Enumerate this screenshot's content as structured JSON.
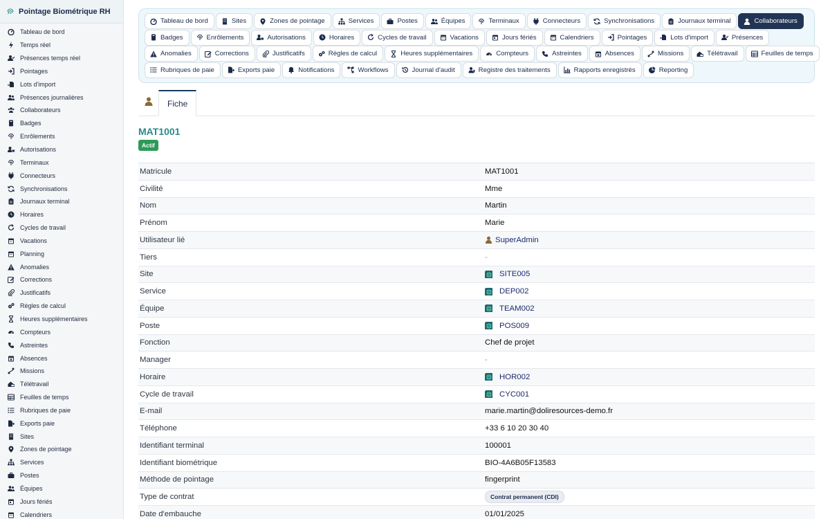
{
  "app": {
    "title": "Pointage Biométrique RH"
  },
  "sidebar": {
    "items": [
      {
        "label": "Tableau de bord",
        "icon": "dashboard-icon"
      },
      {
        "label": "Temps réel",
        "icon": "bolt-icon"
      },
      {
        "label": "Présences temps réel",
        "icon": "user-check-icon"
      },
      {
        "label": "Pointages",
        "icon": "login-icon"
      },
      {
        "label": "Lots d'import",
        "icon": "file-import-icon"
      },
      {
        "label": "Présences journalières",
        "icon": "users-icon"
      },
      {
        "label": "Collaborateurs",
        "icon": "users-group-icon"
      },
      {
        "label": "Badges",
        "icon": "badge-icon"
      },
      {
        "label": "Enrôlements",
        "icon": "fingerprint-icon"
      },
      {
        "label": "Autorisations",
        "icon": "user-lock-icon"
      },
      {
        "label": "Terminaux",
        "icon": "fingerprint-icon"
      },
      {
        "label": "Connecteurs",
        "icon": "plug-icon"
      },
      {
        "label": "Synchronisations",
        "icon": "sync-icon"
      },
      {
        "label": "Journaux terminal",
        "icon": "clipboard-icon"
      },
      {
        "label": "Horaires",
        "icon": "clock-icon"
      },
      {
        "label": "Cycles de travail",
        "icon": "rotate-icon"
      },
      {
        "label": "Vacations",
        "icon": "calendar-icon"
      },
      {
        "label": "Planning",
        "icon": "calendar-icon"
      },
      {
        "label": "Anomalies",
        "icon": "warning-icon"
      },
      {
        "label": "Corrections",
        "icon": "edit-icon"
      },
      {
        "label": "Justificatifs",
        "icon": "paperclip-icon"
      },
      {
        "label": "Règles de calcul",
        "icon": "cogs-icon"
      },
      {
        "label": "Heures supplémentaires",
        "icon": "hourglass-icon"
      },
      {
        "label": "Compteurs",
        "icon": "gauge-icon"
      },
      {
        "label": "Astreintes",
        "icon": "phone-icon"
      },
      {
        "label": "Absences",
        "icon": "calendar-x-icon"
      },
      {
        "label": "Missions",
        "icon": "route-icon"
      },
      {
        "label": "Télétravail",
        "icon": "house-laptop-icon"
      },
      {
        "label": "Feuilles de temps",
        "icon": "table-icon"
      },
      {
        "label": "Rubriques de paie",
        "icon": "list-icon"
      },
      {
        "label": "Exports paie",
        "icon": "file-export-icon"
      },
      {
        "label": "Sites",
        "icon": "building-icon"
      },
      {
        "label": "Zones de pointage",
        "icon": "map-pin-icon"
      },
      {
        "label": "Services",
        "icon": "sitemap-icon"
      },
      {
        "label": "Postes",
        "icon": "briefcase-icon"
      },
      {
        "label": "Équipes",
        "icon": "users-icon"
      },
      {
        "label": "Jours fériés",
        "icon": "calendar-day-icon"
      },
      {
        "label": "Calendriers",
        "icon": "calendar-icon"
      }
    ]
  },
  "topmenu": {
    "rows": [
      [
        {
          "label": "Tableau de bord",
          "icon": "dashboard-icon"
        },
        {
          "label": "Sites",
          "icon": "building-icon"
        },
        {
          "label": "Zones de pointage",
          "icon": "map-pin-icon"
        },
        {
          "label": "Services",
          "icon": "sitemap-icon"
        },
        {
          "label": "Postes",
          "icon": "briefcase-icon"
        },
        {
          "label": "Équipes",
          "icon": "users-icon"
        },
        {
          "label": "Terminaux",
          "icon": "fingerprint-icon"
        },
        {
          "label": "Connecteurs",
          "icon": "plug-icon"
        },
        {
          "label": "Synchronisations",
          "icon": "sync-icon"
        },
        {
          "label": "Journaux terminal",
          "icon": "clipboard-icon"
        },
        {
          "label": "Collaborateurs",
          "icon": "user-icon",
          "active": true
        }
      ],
      [
        {
          "label": "Badges",
          "icon": "badge-icon"
        },
        {
          "label": "Enrôlements",
          "icon": "fingerprint-icon"
        },
        {
          "label": "Autorisations",
          "icon": "user-lock-icon"
        },
        {
          "label": "Horaires",
          "icon": "clock-icon"
        },
        {
          "label": "Cycles de travail",
          "icon": "rotate-icon"
        },
        {
          "label": "Vacations",
          "icon": "calendar-icon"
        },
        {
          "label": "Jours fériés",
          "icon": "calendar-day-icon"
        },
        {
          "label": "Calendriers",
          "icon": "calendar-icon"
        },
        {
          "label": "Pointages",
          "icon": "login-icon"
        },
        {
          "label": "Lots d'import",
          "icon": "file-import-icon"
        },
        {
          "label": "Présences",
          "icon": "user-check-icon"
        }
      ],
      [
        {
          "label": "Anomalies",
          "icon": "warning-icon"
        },
        {
          "label": "Corrections",
          "icon": "edit-icon"
        },
        {
          "label": "Justificatifs",
          "icon": "paperclip-icon"
        },
        {
          "label": "Règles de calcul",
          "icon": "cogs-icon"
        },
        {
          "label": "Heures supplémentaires",
          "icon": "hourglass-icon"
        },
        {
          "label": "Compteurs",
          "icon": "gauge-icon"
        },
        {
          "label": "Astreintes",
          "icon": "phone-icon"
        },
        {
          "label": "Absences",
          "icon": "calendar-x-icon"
        },
        {
          "label": "Missions",
          "icon": "route-icon"
        },
        {
          "label": "Télétravail",
          "icon": "house-laptop-icon"
        },
        {
          "label": "Feuilles de temps",
          "icon": "table-icon"
        }
      ],
      [
        {
          "label": "Rubriques de paie",
          "icon": "list-icon"
        },
        {
          "label": "Exports paie",
          "icon": "file-export-icon"
        },
        {
          "label": "Notifications",
          "icon": "bell-icon"
        },
        {
          "label": "Workflows",
          "icon": "workflow-icon"
        },
        {
          "label": "Journal d'audit",
          "icon": "history-icon"
        },
        {
          "label": "Registre des traitements",
          "icon": "user-shield-icon"
        },
        {
          "label": "Rapports enregistrés",
          "icon": "chart-icon"
        },
        {
          "label": "Reporting",
          "icon": "pie-chart-icon"
        }
      ]
    ]
  },
  "tabs": {
    "fiche_label": "Fiche"
  },
  "record": {
    "ref": "MAT1001",
    "status": "Actif",
    "fields": [
      {
        "label": "Matricule",
        "value": "MAT1001",
        "type": "text"
      },
      {
        "label": "Civilité",
        "value": "Mme",
        "type": "text"
      },
      {
        "label": "Nom",
        "value": "Martin",
        "type": "text"
      },
      {
        "label": "Prénom",
        "value": "Marie",
        "type": "text"
      },
      {
        "label": "Utilisateur lié",
        "value": "SuperAdmin",
        "type": "user"
      },
      {
        "label": "Tiers",
        "value": "-",
        "type": "dash"
      },
      {
        "label": "Site",
        "value": "SITE005",
        "type": "link"
      },
      {
        "label": "Service",
        "value": "DEP002",
        "type": "link"
      },
      {
        "label": "Équipe",
        "value": "TEAM002",
        "type": "link"
      },
      {
        "label": "Poste",
        "value": "POS009",
        "type": "link"
      },
      {
        "label": "Fonction",
        "value": "Chef de projet",
        "type": "text"
      },
      {
        "label": "Manager",
        "value": "-",
        "type": "dash"
      },
      {
        "label": "Horaire",
        "value": "HOR002",
        "type": "link"
      },
      {
        "label": "Cycle de travail",
        "value": "CYC001",
        "type": "link"
      },
      {
        "label": "E-mail",
        "value": "marie.martin@doliresources-demo.fr",
        "type": "text"
      },
      {
        "label": "Téléphone",
        "value": "+33 6 10 20 30 40",
        "type": "text"
      },
      {
        "label": "Identifiant terminal",
        "value": "100001",
        "type": "text"
      },
      {
        "label": "Identifiant biométrique",
        "value": "BIO-4A6B05F13583",
        "type": "text"
      },
      {
        "label": "Méthode de pointage",
        "value": "fingerprint",
        "type": "text"
      },
      {
        "label": "Type de contrat",
        "value": "Contrat permanent (CDI)",
        "type": "pill"
      },
      {
        "label": "Date d'embauche",
        "value": "01/01/2025",
        "type": "text"
      }
    ]
  },
  "colors": {
    "active_nav": "#223455",
    "status_badge": "#2e9a5a",
    "ref_title": "#2a8a8a",
    "link": "#1b2b6b"
  }
}
